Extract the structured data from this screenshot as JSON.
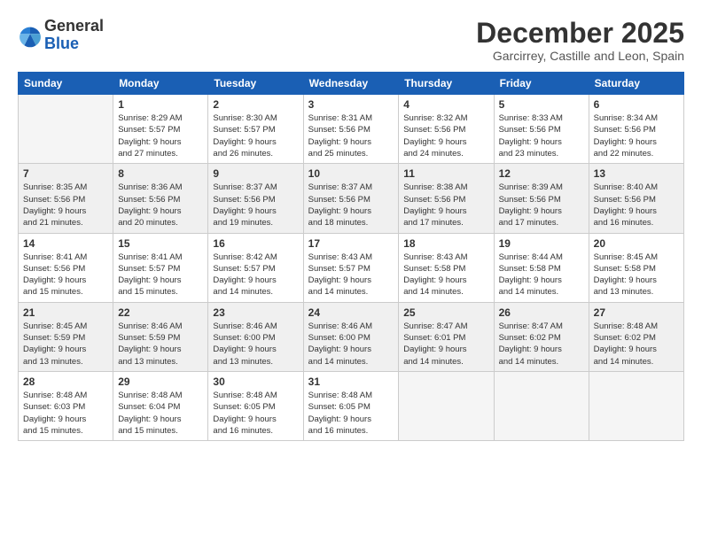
{
  "logo": {
    "line1": "General",
    "line2": "Blue"
  },
  "title": "December 2025",
  "location": "Garcirrey, Castille and Leon, Spain",
  "days_header": [
    "Sunday",
    "Monday",
    "Tuesday",
    "Wednesday",
    "Thursday",
    "Friday",
    "Saturday"
  ],
  "weeks": [
    [
      {
        "num": "",
        "info": ""
      },
      {
        "num": "1",
        "info": "Sunrise: 8:29 AM\nSunset: 5:57 PM\nDaylight: 9 hours\nand 27 minutes."
      },
      {
        "num": "2",
        "info": "Sunrise: 8:30 AM\nSunset: 5:57 PM\nDaylight: 9 hours\nand 26 minutes."
      },
      {
        "num": "3",
        "info": "Sunrise: 8:31 AM\nSunset: 5:56 PM\nDaylight: 9 hours\nand 25 minutes."
      },
      {
        "num": "4",
        "info": "Sunrise: 8:32 AM\nSunset: 5:56 PM\nDaylight: 9 hours\nand 24 minutes."
      },
      {
        "num": "5",
        "info": "Sunrise: 8:33 AM\nSunset: 5:56 PM\nDaylight: 9 hours\nand 23 minutes."
      },
      {
        "num": "6",
        "info": "Sunrise: 8:34 AM\nSunset: 5:56 PM\nDaylight: 9 hours\nand 22 minutes."
      }
    ],
    [
      {
        "num": "7",
        "info": "Sunrise: 8:35 AM\nSunset: 5:56 PM\nDaylight: 9 hours\nand 21 minutes."
      },
      {
        "num": "8",
        "info": "Sunrise: 8:36 AM\nSunset: 5:56 PM\nDaylight: 9 hours\nand 20 minutes."
      },
      {
        "num": "9",
        "info": "Sunrise: 8:37 AM\nSunset: 5:56 PM\nDaylight: 9 hours\nand 19 minutes."
      },
      {
        "num": "10",
        "info": "Sunrise: 8:37 AM\nSunset: 5:56 PM\nDaylight: 9 hours\nand 18 minutes."
      },
      {
        "num": "11",
        "info": "Sunrise: 8:38 AM\nSunset: 5:56 PM\nDaylight: 9 hours\nand 17 minutes."
      },
      {
        "num": "12",
        "info": "Sunrise: 8:39 AM\nSunset: 5:56 PM\nDaylight: 9 hours\nand 17 minutes."
      },
      {
        "num": "13",
        "info": "Sunrise: 8:40 AM\nSunset: 5:56 PM\nDaylight: 9 hours\nand 16 minutes."
      }
    ],
    [
      {
        "num": "14",
        "info": "Sunrise: 8:41 AM\nSunset: 5:56 PM\nDaylight: 9 hours\nand 15 minutes."
      },
      {
        "num": "15",
        "info": "Sunrise: 8:41 AM\nSunset: 5:57 PM\nDaylight: 9 hours\nand 15 minutes."
      },
      {
        "num": "16",
        "info": "Sunrise: 8:42 AM\nSunset: 5:57 PM\nDaylight: 9 hours\nand 14 minutes."
      },
      {
        "num": "17",
        "info": "Sunrise: 8:43 AM\nSunset: 5:57 PM\nDaylight: 9 hours\nand 14 minutes."
      },
      {
        "num": "18",
        "info": "Sunrise: 8:43 AM\nSunset: 5:58 PM\nDaylight: 9 hours\nand 14 minutes."
      },
      {
        "num": "19",
        "info": "Sunrise: 8:44 AM\nSunset: 5:58 PM\nDaylight: 9 hours\nand 14 minutes."
      },
      {
        "num": "20",
        "info": "Sunrise: 8:45 AM\nSunset: 5:58 PM\nDaylight: 9 hours\nand 13 minutes."
      }
    ],
    [
      {
        "num": "21",
        "info": "Sunrise: 8:45 AM\nSunset: 5:59 PM\nDaylight: 9 hours\nand 13 minutes."
      },
      {
        "num": "22",
        "info": "Sunrise: 8:46 AM\nSunset: 5:59 PM\nDaylight: 9 hours\nand 13 minutes."
      },
      {
        "num": "23",
        "info": "Sunrise: 8:46 AM\nSunset: 6:00 PM\nDaylight: 9 hours\nand 13 minutes."
      },
      {
        "num": "24",
        "info": "Sunrise: 8:46 AM\nSunset: 6:00 PM\nDaylight: 9 hours\nand 14 minutes."
      },
      {
        "num": "25",
        "info": "Sunrise: 8:47 AM\nSunset: 6:01 PM\nDaylight: 9 hours\nand 14 minutes."
      },
      {
        "num": "26",
        "info": "Sunrise: 8:47 AM\nSunset: 6:02 PM\nDaylight: 9 hours\nand 14 minutes."
      },
      {
        "num": "27",
        "info": "Sunrise: 8:48 AM\nSunset: 6:02 PM\nDaylight: 9 hours\nand 14 minutes."
      }
    ],
    [
      {
        "num": "28",
        "info": "Sunrise: 8:48 AM\nSunset: 6:03 PM\nDaylight: 9 hours\nand 15 minutes."
      },
      {
        "num": "29",
        "info": "Sunrise: 8:48 AM\nSunset: 6:04 PM\nDaylight: 9 hours\nand 15 minutes."
      },
      {
        "num": "30",
        "info": "Sunrise: 8:48 AM\nSunset: 6:05 PM\nDaylight: 9 hours\nand 16 minutes."
      },
      {
        "num": "31",
        "info": "Sunrise: 8:48 AM\nSunset: 6:05 PM\nDaylight: 9 hours\nand 16 minutes."
      },
      {
        "num": "",
        "info": ""
      },
      {
        "num": "",
        "info": ""
      },
      {
        "num": "",
        "info": ""
      }
    ]
  ]
}
